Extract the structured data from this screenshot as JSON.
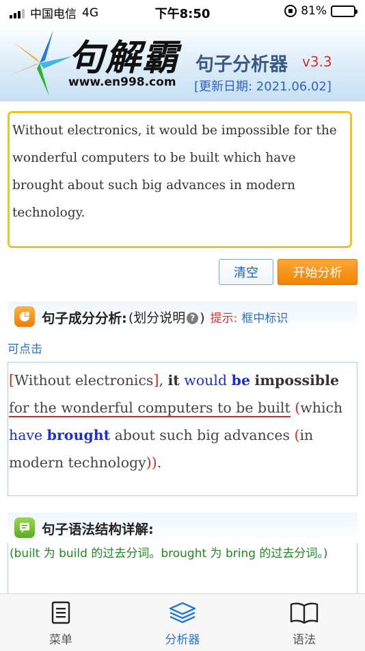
{
  "status_bar": {
    "carrier": "中国电信",
    "network": "4G",
    "time": "下午8:50",
    "battery": "81%",
    "battery_level": 0.81
  },
  "header": {
    "logo_title": "句解霸",
    "logo_site": "www.en998.com",
    "app_name": "句子分析器",
    "version": "v3.3",
    "update_date": "[更新日期: 2021.06.02]"
  },
  "input": {
    "value": "Without electronics, it would be impossible for the wonderful computers to be built which have brought about such big advances in modern technology."
  },
  "buttons": {
    "clear": "清空",
    "analyze": "开始分析"
  },
  "analysis_section": {
    "title": "句子成分分析:",
    "legend_open": "(划分说明",
    "legend_close": ")",
    "hint_label": "提示:",
    "hint_text_1": "框中标识",
    "hint_text_2": "可点击",
    "lines": [
      [
        {
          "text": "[",
          "style": "red"
        },
        {
          "text": "Without electronics",
          "style": "plain"
        },
        {
          "text": "]",
          "style": "red"
        },
        {
          "text": ", ",
          "style": "plain"
        },
        {
          "text": "it",
          "style": "bold-dark"
        },
        {
          "text": " ",
          "style": "plain"
        },
        {
          "text": "would",
          "style": "blue"
        },
        {
          "text": " ",
          "style": "plain"
        },
        {
          "text": "be",
          "style": "bold-blue"
        },
        {
          "text": " ",
          "style": "plain"
        },
        {
          "text": "impossible",
          "style": "bold-dark"
        }
      ],
      [
        {
          "text": "for the wonderful computers to be built",
          "style": "underline"
        },
        {
          "text": " ",
          "style": "plain"
        },
        {
          "text": "(",
          "style": "red"
        },
        {
          "text": "which",
          "style": "plain"
        }
      ],
      [
        {
          "text": "have",
          "style": "blue"
        },
        {
          "text": " ",
          "style": "plain"
        },
        {
          "text": "brought",
          "style": "bold-blue"
        },
        {
          "text": " about such big advances ",
          "style": "plain"
        },
        {
          "text": "(",
          "style": "red"
        },
        {
          "text": "in",
          "style": "plain"
        }
      ],
      [
        {
          "text": "modern technology",
          "style": "plain"
        },
        {
          "text": "))",
          "style": "red"
        },
        {
          "text": ".",
          "style": "plain"
        }
      ]
    ]
  },
  "grammar_section": {
    "title": "句子语法结构详解:",
    "explanation": "(built 为 build 的过去分词。brought 为 bring 的过去分词。)"
  },
  "tab_bar": {
    "tabs": [
      {
        "label": "菜单",
        "icon": "menu-document-icon",
        "active": false
      },
      {
        "label": "分析器",
        "icon": "layers-icon",
        "active": true
      },
      {
        "label": "语法",
        "icon": "book-icon",
        "active": false
      }
    ]
  },
  "colors": {
    "accent_blue": "#1e78d8",
    "analyze_orange": "#f08400",
    "input_border": "#f2c122",
    "mark_red": "#e0241d",
    "verb_blue": "#1a2fd6",
    "explain_green": "#1d8a1d"
  }
}
